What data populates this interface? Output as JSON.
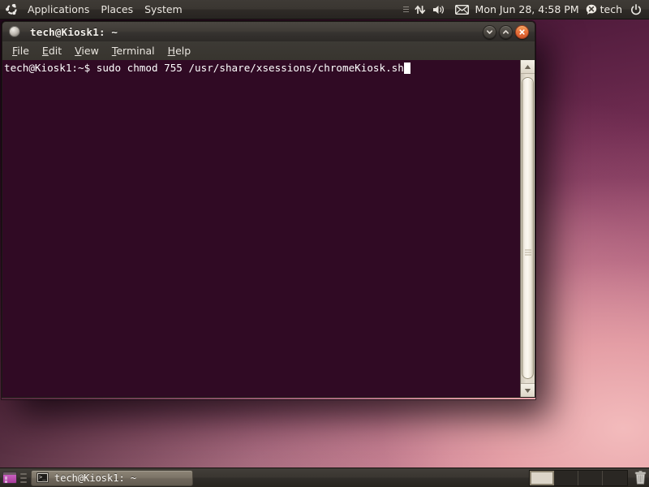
{
  "desktop": {
    "wallpaper_name": "ubuntu-aubergine-gradient",
    "colors": {
      "terminal_bg": "#300a24",
      "panel_bg": "#3a3631",
      "close_button": "#e8713a",
      "terminal_text": "#ffffff"
    }
  },
  "top_panel": {
    "logo": "ubuntu-logo",
    "menus": [
      {
        "label": "Applications",
        "name": "menu-applications"
      },
      {
        "label": "Places",
        "name": "menu-places"
      },
      {
        "label": "System",
        "name": "menu-system"
      }
    ],
    "tray": {
      "indicator_applet_grip": "grip-handle",
      "network_icon": "network-up-down-icon",
      "volume_icon": "volume-speaker-icon",
      "messaging_icon": "envelope-icon",
      "clock": "Mon Jun 28,  4:58 PM",
      "user_status_icon": "user-status-away-icon",
      "user_name": "tech",
      "power_icon": "power-button-icon"
    }
  },
  "terminal_window": {
    "title": "tech@Kiosk1: ~",
    "window_menu_icon": "window-menu-icon",
    "buttons": {
      "minimize": "minimize-chevron-down-icon",
      "maximize": "maximize-chevron-up-icon",
      "close": "close-x-icon"
    },
    "menubar": [
      {
        "label": "File",
        "mnemonic": "F",
        "rest": "ile",
        "name": "menu-file"
      },
      {
        "label": "Edit",
        "mnemonic": "E",
        "rest": "dit",
        "name": "menu-edit"
      },
      {
        "label": "View",
        "mnemonic": "V",
        "rest": "iew",
        "name": "menu-view"
      },
      {
        "label": "Terminal",
        "mnemonic": "T",
        "rest": "erminal",
        "name": "menu-terminal"
      },
      {
        "label": "Help",
        "mnemonic": "H",
        "rest": "elp",
        "name": "menu-help"
      }
    ],
    "content": {
      "prompt": "tech@Kiosk1:~$ ",
      "command": "sudo chmod 755 /usr/share/xsessions/chromeKiosk.sh",
      "full_line": "tech@Kiosk1:~$ sudo chmod 755 /usr/share/xsessions/chromeKiosk.sh",
      "cursor": "block-cursor"
    },
    "scrollbar": {
      "up_arrow": "scroll-up-arrow-icon",
      "down_arrow": "scroll-down-arrow-icon",
      "thumb": "scrollbar-thumb",
      "grip": "scrollbar-grip"
    }
  },
  "bottom_panel": {
    "show_desktop_icon": "show-desktop-icon",
    "grip": "panel-grip",
    "task_button": {
      "icon": "terminal-icon",
      "label": "tech@Kiosk1: ~"
    },
    "workspaces": [
      {
        "name": "workspace-1",
        "active": true
      },
      {
        "name": "workspace-2",
        "active": false
      },
      {
        "name": "workspace-3",
        "active": false
      },
      {
        "name": "workspace-4",
        "active": false
      }
    ],
    "trash_icon": "trash-can-icon"
  }
}
